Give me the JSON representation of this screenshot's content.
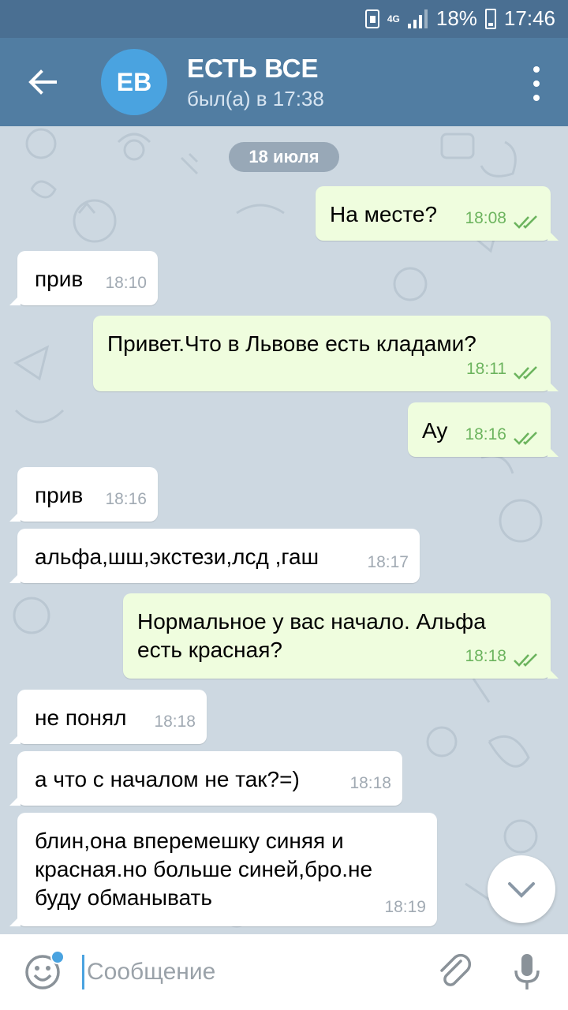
{
  "statusbar": {
    "network": "4G",
    "battery": "18%",
    "time": "17:46"
  },
  "header": {
    "avatar_initials": "EB",
    "title": "ЕСТЬ ВСЕ",
    "status": "был(а) в 17:38"
  },
  "chat": {
    "date_label": "18 июля",
    "messages": [
      {
        "dir": "out",
        "text": "На месте?",
        "time": "18:08"
      },
      {
        "dir": "in",
        "text": "прив",
        "time": "18:10"
      },
      {
        "dir": "out",
        "text": "Привет.Что в Львове есть кладами?",
        "time": "18:11"
      },
      {
        "dir": "out",
        "text": "Ау",
        "time": "18:16"
      },
      {
        "dir": "in",
        "text": "прив",
        "time": "18:16"
      },
      {
        "dir": "in",
        "text": "альфа,шш,экстези,лсд ,гаш",
        "time": "18:17"
      },
      {
        "dir": "out",
        "text": "Нормальное у вас начало. Альфа есть красная?",
        "text_lines": [
          "Нормальное у вас начало. Альфа",
          "есть красная?"
        ],
        "time": "18:18"
      },
      {
        "dir": "in",
        "text": "не понял",
        "time": "18:18"
      },
      {
        "dir": "in",
        "text": "а что с началом не так?=)",
        "time": "18:18"
      },
      {
        "dir": "in",
        "text": "блин,она вперемешку синяя и красная.но больше синей,бро.не буду обманывать",
        "text_lines": [
          "блин,она вперемешку синяя и",
          "красная.но больше синей,бро.не",
          "буду обманывать"
        ],
        "time": "18:19"
      }
    ]
  },
  "composer": {
    "placeholder": "Сообщение"
  },
  "colors": {
    "header": "#517da2",
    "statusbar": "#4a6f92",
    "outgoing_bubble": "#effdde",
    "incoming_bubble": "#ffffff",
    "accent": "#4aa3e0",
    "read_ticks": "#6cb45e"
  },
  "icons": {
    "back": "arrow-left-icon",
    "menu": "more-vertical-icon",
    "read": "double-check-icon",
    "scroll_down": "chevron-down-icon",
    "emoji": "smiley-icon",
    "attach": "paperclip-icon",
    "mic": "microphone-icon"
  }
}
